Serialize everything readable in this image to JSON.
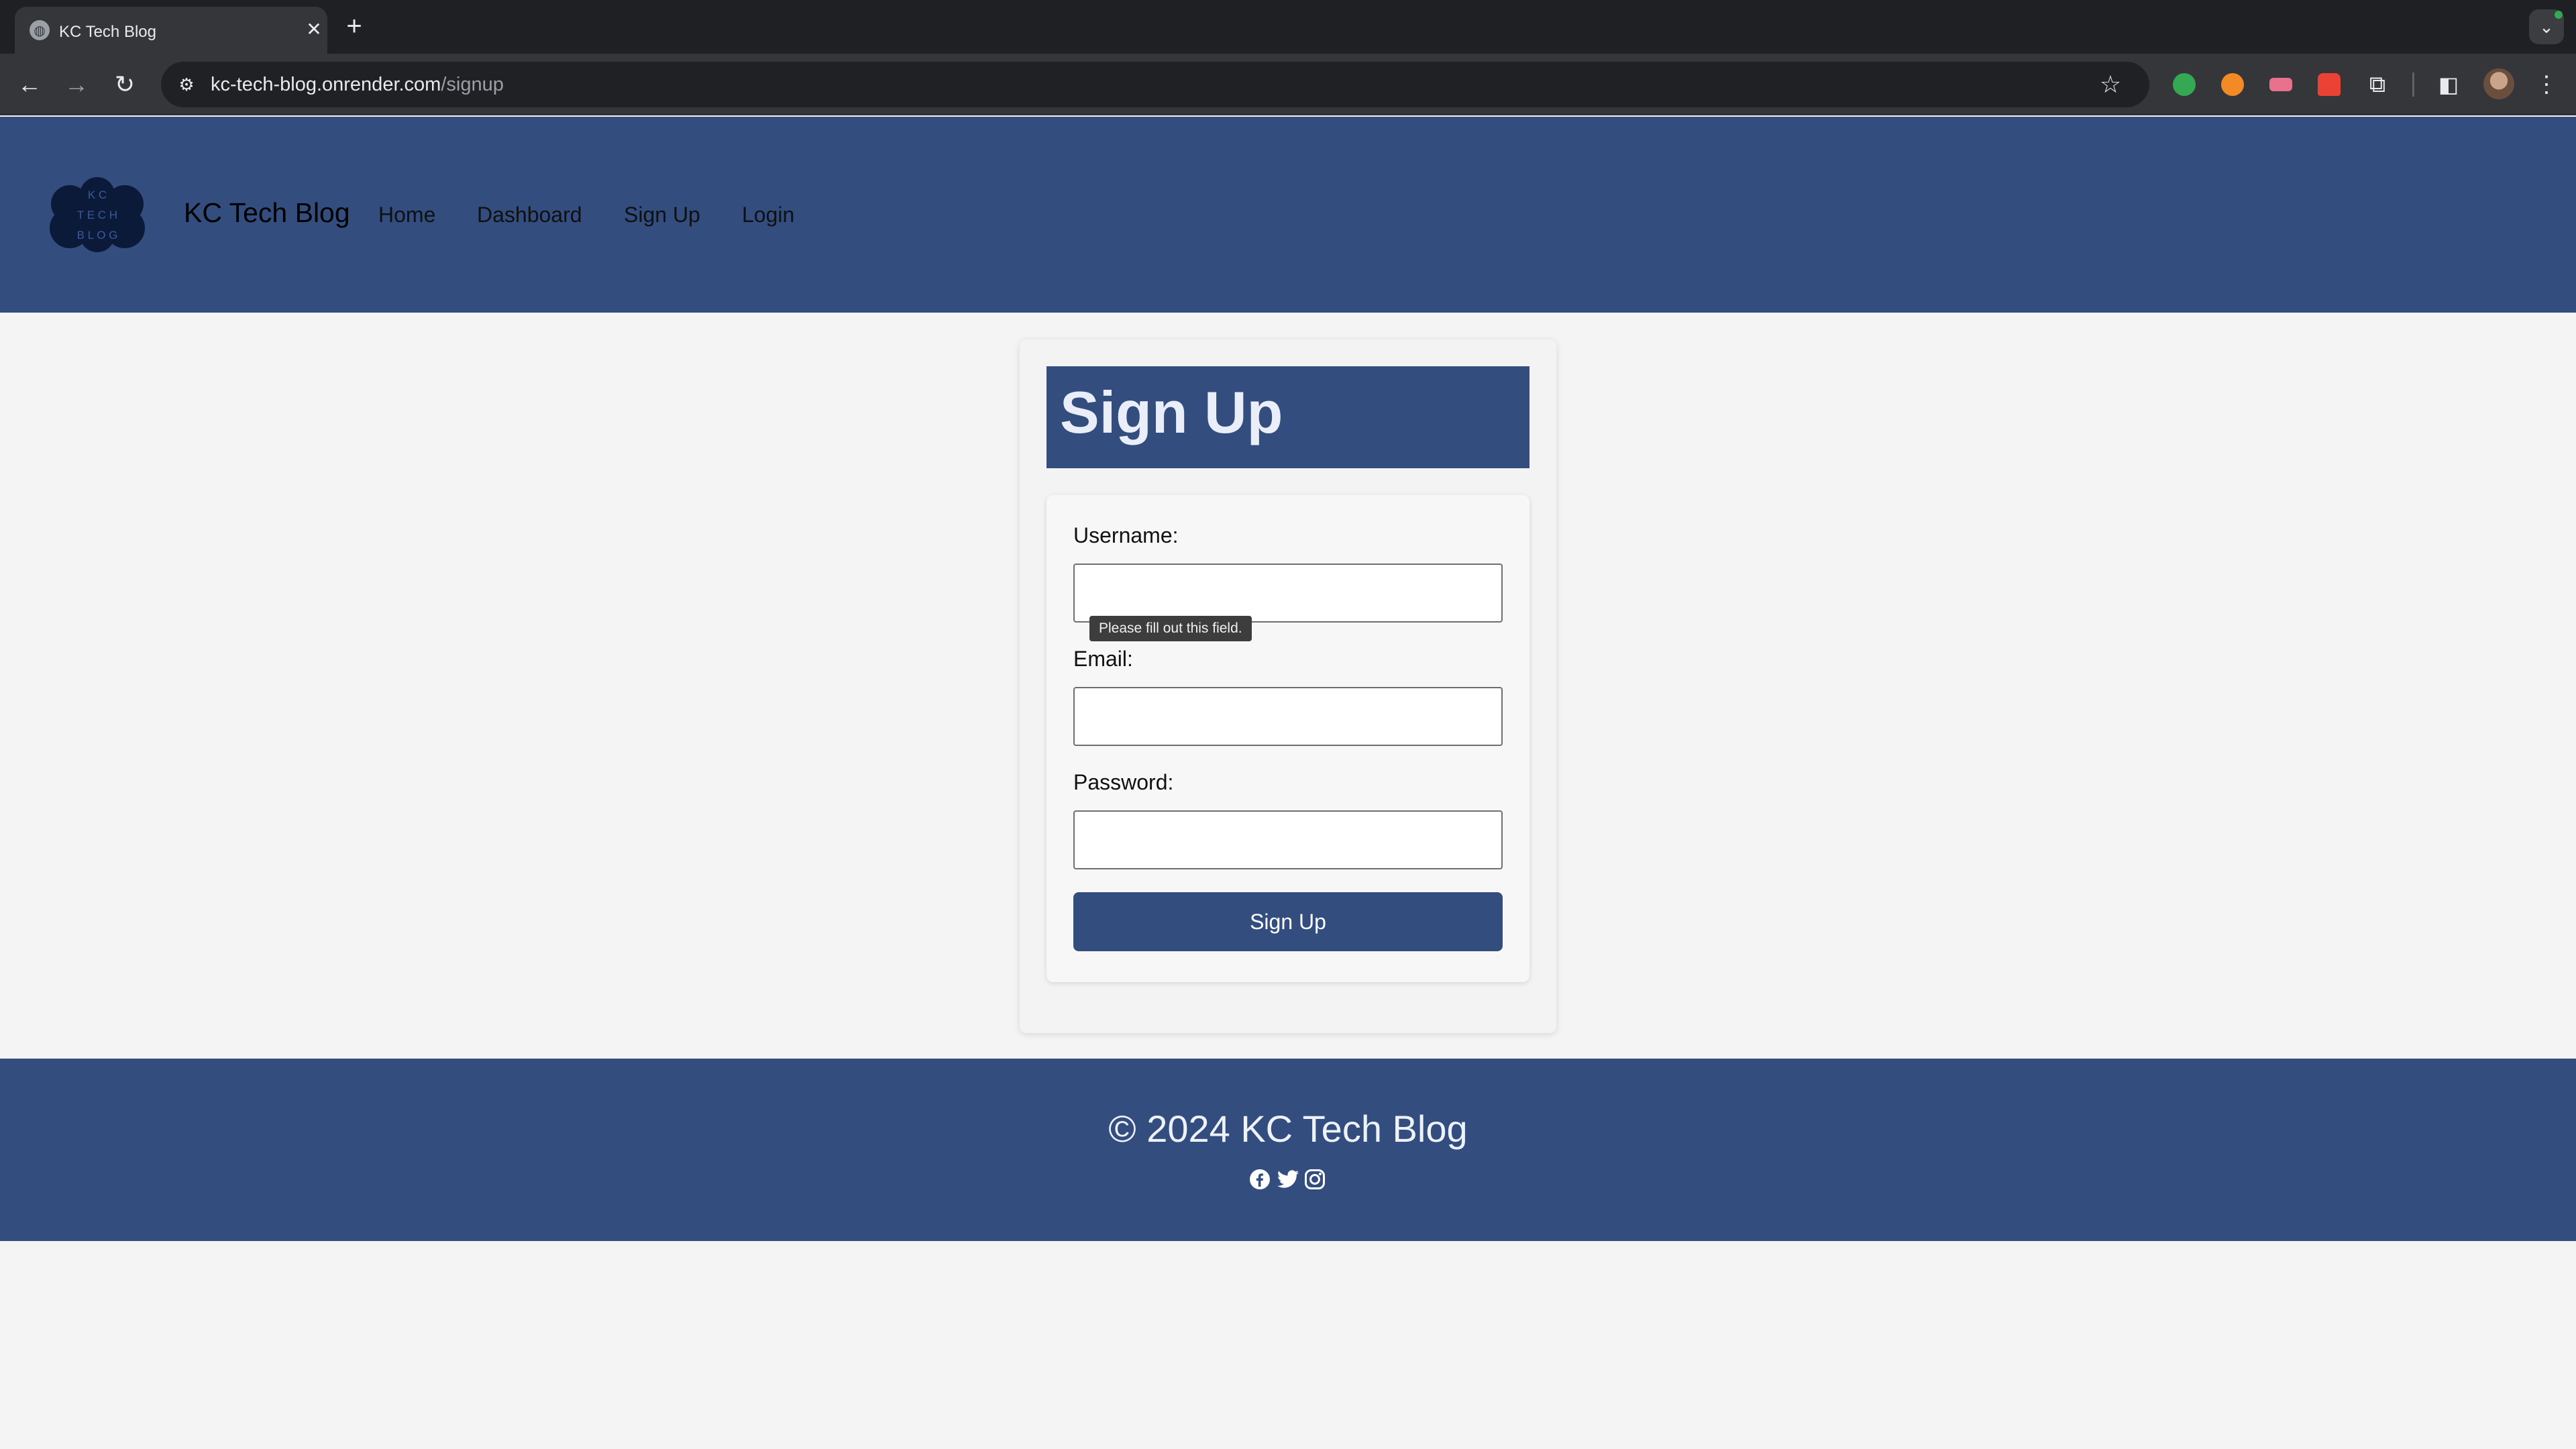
{
  "browser": {
    "tab_title": "KC Tech Blog",
    "url_host": "kc-tech-blog.onrender.com",
    "url_path": "/signup"
  },
  "site": {
    "logo_lines": [
      "K C",
      "T E C H",
      "B L O G"
    ],
    "brand": "KC Tech Blog",
    "nav": [
      "Home",
      "Dashboard",
      "Sign Up",
      "Login"
    ]
  },
  "form": {
    "title": "Sign Up",
    "username_label": "Username:",
    "username_value": "",
    "email_label": "Email:",
    "email_value": "",
    "password_label": "Password:",
    "password_value": "",
    "validation_tooltip": "Please fill out this field.",
    "submit_label": "Sign Up"
  },
  "footer": {
    "copyright": "© 2024 KC Tech Blog",
    "social_icons": [
      "facebook-icon",
      "twitter-icon",
      "instagram-icon"
    ]
  },
  "colors": {
    "brand_blue": "#324d7e",
    "page_bg": "#f4f4f4",
    "chrome_dark": "#35363a"
  }
}
